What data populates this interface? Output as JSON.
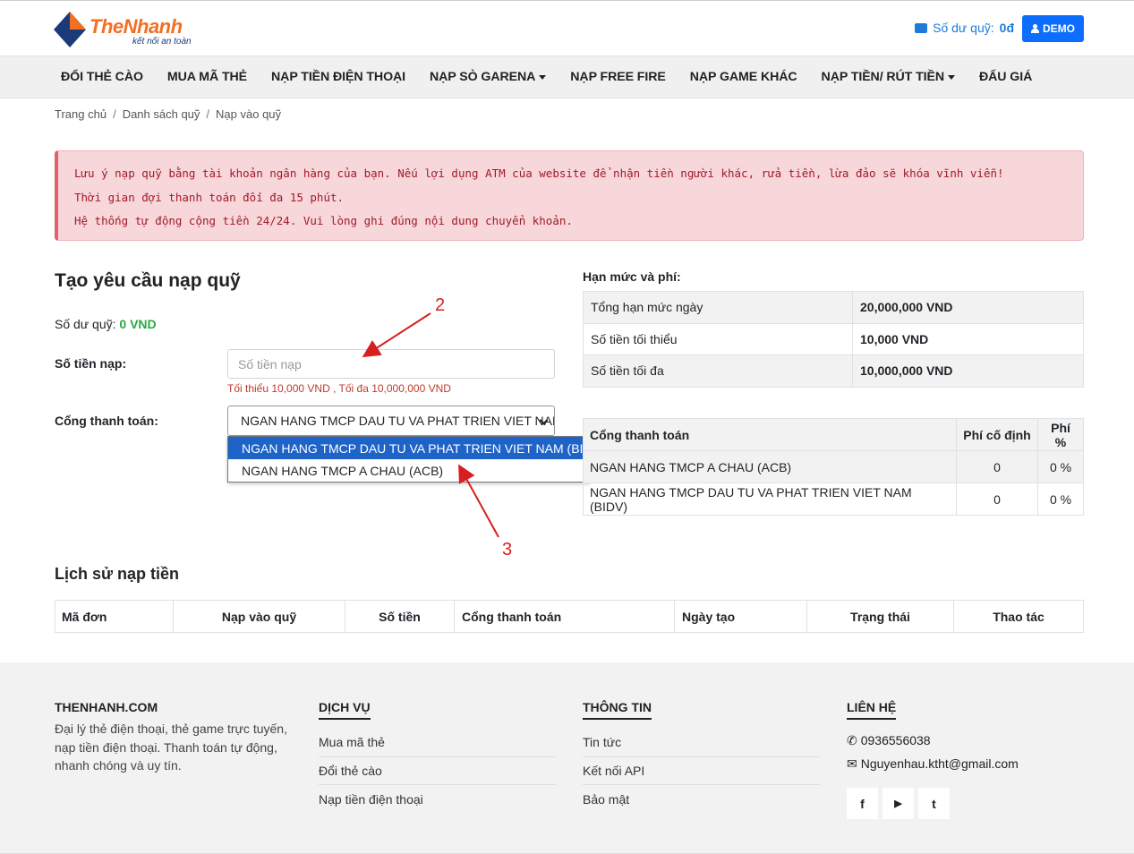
{
  "header": {
    "logo_text": "TheNhanh",
    "logo_tagline": "kết nối an toàn",
    "balance_label": "Số dư quỹ:",
    "balance_value": "0đ",
    "demo_label": "DEMO"
  },
  "nav": {
    "items": [
      {
        "label": "ĐỔI THẺ CÀO"
      },
      {
        "label": "MUA MÃ THẺ"
      },
      {
        "label": "NẠP TIỀN ĐIỆN THOẠI"
      },
      {
        "label": "NẠP SÒ GARENA"
      },
      {
        "label": "NẠP FREE FIRE"
      },
      {
        "label": "NẠP GAME KHÁC"
      },
      {
        "label": "NẠP TIỀN/ RÚT TIỀN"
      },
      {
        "label": "ĐẤU GIÁ"
      }
    ]
  },
  "breadcrumb": [
    "Trang chủ",
    "Danh sách quỹ",
    "Nạp vào quỹ"
  ],
  "alert": {
    "line1": "Lưu ý nạp quỹ bằng tài khoản ngân hàng của bạn. Nếu lợi dụng ATM của website để nhận tiền người khác, rửa tiền, lừa đảo sẽ khóa vĩnh viễn!",
    "line2": "Thời gian đợi thanh toán đối đa 15 phút.",
    "line3": "Hệ thống tự động cộng tiền 24/24. Vui lòng ghi đúng nội dung chuyển khoản."
  },
  "form": {
    "title": "Tạo yêu cầu nạp quỹ",
    "balance_label": "Số dư quỹ:",
    "balance_value": "0 VND",
    "amount_label": "Số tiền nạp:",
    "amount_placeholder": "Số tiền nạp",
    "amount_hint": "Tối thiểu 10,000 VND , Tối đa 10,000,000 VND",
    "gateway_label": "Cổng thanh toán:",
    "gateway_selected": "NGAN HANG TMCP DAU TU VA PHAT TRIEN VIET NAM (BIDV)",
    "gateway_options": [
      "NGAN HANG TMCP DAU TU VA PHAT TRIEN VIET NAM (BIDV)",
      "NGAN HANG TMCP A CHAU (ACB)"
    ]
  },
  "limits": {
    "title": "Hạn mức và phí:",
    "rows": [
      {
        "label": "Tổng hạn mức ngày",
        "value": "20,000,000 VND"
      },
      {
        "label": "Số tiền tối thiểu",
        "value": "10,000 VND"
      },
      {
        "label": "Số tiền tối đa",
        "value": "10,000,000 VND"
      }
    ]
  },
  "fees": {
    "headers": [
      "Cổng thanh toán",
      "Phí cố định",
      "Phí %"
    ],
    "rows": [
      [
        "NGAN HANG TMCP A CHAU (ACB)",
        "0",
        "0 %"
      ],
      [
        "NGAN HANG TMCP DAU TU VA PHAT TRIEN VIET NAM (BIDV)",
        "0",
        "0 %"
      ]
    ]
  },
  "history": {
    "title": "Lịch sử nạp tiền",
    "headers": [
      "Mã đơn",
      "Nạp vào quỹ",
      "Số tiền",
      "Cổng thanh toán",
      "Ngày tạo",
      "Trạng thái",
      "Thao tác"
    ]
  },
  "footer": {
    "brand_title": "THENHANH.COM",
    "brand_desc": "Đại lý thẻ điện thoại, thẻ game trực tuyến, nạp tiền điện thoại. Thanh toán tự động, nhanh chóng và uy tín.",
    "services_title": "DỊCH VỤ",
    "services": [
      "Mua mã thẻ",
      "Đổi thẻ cào",
      "Nạp tiền điện thoại"
    ],
    "info_title": "THÔNG TIN",
    "info": [
      "Tin tức",
      "Kết nối API",
      "Bảo mật"
    ],
    "contact_title": "LIÊN HỆ",
    "phone": "0936556038",
    "email": "Nguyenhau.ktht@gmail.com",
    "social": [
      "f",
      "▶",
      "t"
    ]
  },
  "annotations": {
    "a2": "2",
    "a3": "3"
  },
  "colors": {
    "brand_orange": "#f37021",
    "brand_blue": "#1a3a7a",
    "primary": "#0d6efd",
    "success": "#28a745",
    "danger": "#a01a2a"
  }
}
